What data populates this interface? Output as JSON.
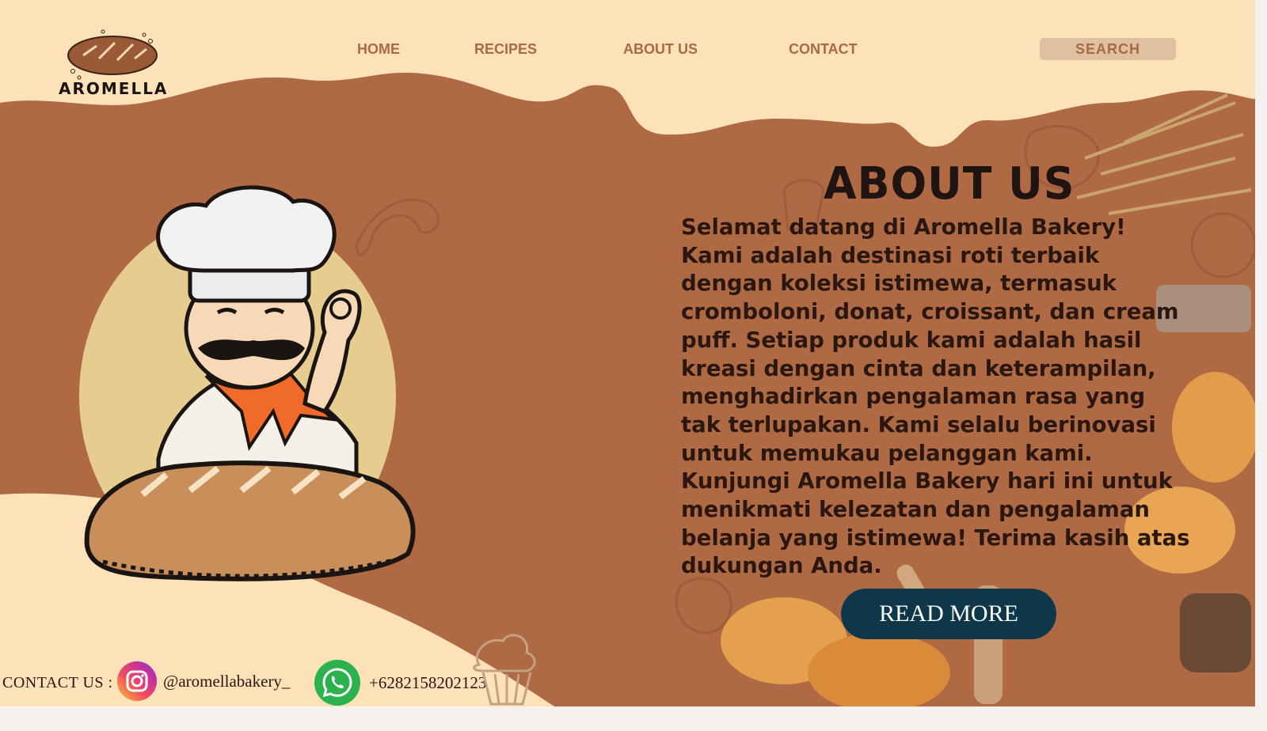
{
  "brand": {
    "name": "AROMELLA"
  },
  "nav": {
    "items": [
      {
        "label": "HOME"
      },
      {
        "label": "RECIPES"
      },
      {
        "label": "ABOUT US"
      },
      {
        "label": "CONTACT"
      }
    ],
    "search_label": "SEARCH"
  },
  "about": {
    "title": "ABOUT US",
    "lines": [
      "Selamat datang di Aromella Bakery!",
      "Kami adalah destinasi roti terbaik",
      "dengan koleksi istimewa, termasuk",
      "cromboloni, donat, croissant, dan cream",
      "puff. Setiap produk kami adalah hasil",
      "kreasi dengan cinta dan keterampilan,",
      "menghadirkan pengalaman rasa yang",
      "tak terlupakan. Kami selalu berinovasi",
      "untuk memukau pelanggan kami.",
      "Kunjungi Aromella Bakery hari ini untuk",
      "menikmati kelezatan dan pengalaman",
      "belanja yang istimewa! Terima kasih atas",
      "dukungan Anda."
    ],
    "read_more": "READ MORE"
  },
  "contact": {
    "label": "CONTACT US :",
    "instagram": "@aromellabakery_",
    "whatsapp": "+6282158202123"
  },
  "colors": {
    "cream": "#fde1b8",
    "brown": "#b06a43",
    "button": "#0e3849",
    "nav_text": "#a86a45"
  },
  "icons": [
    "bread-logo-icon",
    "instagram-icon",
    "whatsapp-icon",
    "chef-illustration"
  ]
}
